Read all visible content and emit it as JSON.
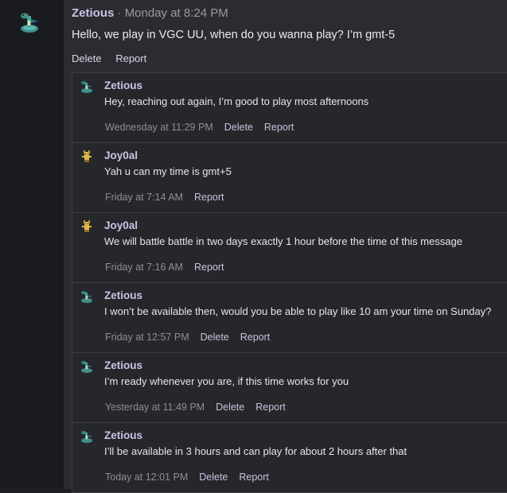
{
  "post": {
    "author": "Zetious",
    "separator": "·",
    "time": "Monday at 8:24 PM",
    "body": "Hello, we play in VGC UU, when do you wanna play? I’m gmt-5",
    "actions": [
      "Delete",
      "Report"
    ],
    "avatar_icon": "dragon-pokemon-sprite-icon"
  },
  "replies": [
    {
      "author": "Zetious",
      "text": "Hey, reaching out again, I’m good to play most afternoons",
      "time": "Wednesday at 11:29 PM",
      "actions": [
        "Delete",
        "Report"
      ],
      "avatar_icon": "dragon-pokemon-sprite-icon"
    },
    {
      "author": "Joy0al",
      "text": "Yah u can my time is gmt+5",
      "time": "Friday at 7:14 AM",
      "actions": [
        "Report"
      ],
      "avatar_icon": "yellow-pokemon-sprite-icon"
    },
    {
      "author": "Joy0al",
      "text": "We will battle battle in two days exactly 1 hour before the time of this message",
      "time": "Friday at 7:16 AM",
      "actions": [
        "Report"
      ],
      "avatar_icon": "yellow-pokemon-sprite-icon"
    },
    {
      "author": "Zetious",
      "text": "I won’t be available then, would you be able to play like 10 am your time on Sunday?",
      "time": "Friday at 12:57 PM",
      "actions": [
        "Delete",
        "Report"
      ],
      "avatar_icon": "dragon-pokemon-sprite-icon"
    },
    {
      "author": "Zetious",
      "text": "I’m ready whenever you are, if this time works for you",
      "time": "Yesterday at 11:49 PM",
      "actions": [
        "Delete",
        "Report"
      ],
      "avatar_icon": "dragon-pokemon-sprite-icon"
    },
    {
      "author": "Zetious",
      "text": "I’ll be available in 3 hours and can play for about 2 hours after that",
      "time": "Today at 12:01 PM",
      "actions": [
        "Delete",
        "Report"
      ],
      "avatar_icon": "dragon-pokemon-sprite-icon"
    }
  ]
}
